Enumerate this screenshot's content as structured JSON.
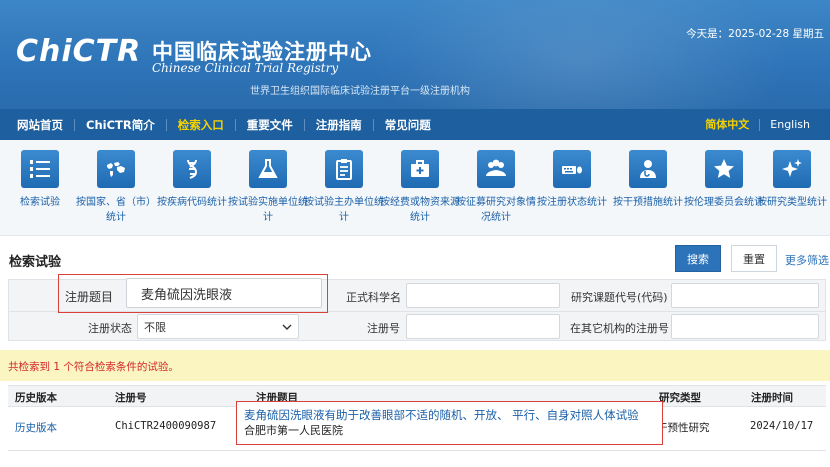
{
  "header": {
    "logo_mark": "ChiCTR",
    "site_name_cn": "中国临床试验注册中心",
    "site_name_en": "Chinese Clinical Trial Registry",
    "site_subtitle": "世界卫生组织国际临床试验注册平台一级注册机构",
    "today": "今天是：2025-02-28 星期五"
  },
  "nav": {
    "items": [
      {
        "label": "网站首页",
        "active": false
      },
      {
        "label": "ChiCTR简介",
        "active": false
      },
      {
        "label": "检索入口",
        "active": true
      },
      {
        "label": "重要文件",
        "active": false
      },
      {
        "label": "注册指南",
        "active": false
      },
      {
        "label": "常见问题",
        "active": false
      }
    ],
    "lang_cn": "简体中文",
    "lang_en": "English"
  },
  "icon_bar": {
    "items": [
      {
        "icon": "list-numbered-icon",
        "label": "检索试验"
      },
      {
        "icon": "world-map-icon",
        "label": "按国家、省（市）统计"
      },
      {
        "icon": "dna-icon",
        "label": "按疾病代码统计"
      },
      {
        "icon": "flask-icon",
        "label": "按试验实施单位统计"
      },
      {
        "icon": "clipboard-icon",
        "label": "按试验主办单位统计"
      },
      {
        "icon": "medical-kit-icon",
        "label": "按经费或物资来源统计"
      },
      {
        "icon": "people-group-icon",
        "label": "按征募研究对象情况统计"
      },
      {
        "icon": "keyboard-mouse-icon",
        "label": "按注册状态统计"
      },
      {
        "icon": "doctor-icon",
        "label": "按干预措施统计"
      },
      {
        "icon": "star-icon",
        "label": "按伦理委员会统计"
      },
      {
        "icon": "sparkle-icon",
        "label": "按研究类型统计"
      }
    ]
  },
  "search": {
    "title": "检索试验",
    "search_button": "搜索",
    "reset_button": "重置",
    "more_filters": "更多筛选",
    "fields": {
      "reg_title_label": "注册题目",
      "reg_title_value": "麦角硫因洗眼液",
      "sci_title_label": "正式科学名",
      "sci_title_value": "",
      "project_code_label": "研究课题代号(代码)",
      "project_code_value": "",
      "reg_status_label": "注册状态",
      "reg_status_value": "不限",
      "reg_no_label": "注册号",
      "reg_no_value": "",
      "other_reg_label": "在其它机构的注册号",
      "other_reg_value": ""
    }
  },
  "results": {
    "summary": "共检索到 1 个符合检索条件的试验。",
    "columns": [
      "历史版本",
      "注册号",
      "注册题目",
      "研究类型",
      "注册时间"
    ],
    "rows": [
      {
        "history": "历史版本",
        "reg_no": "ChiCTR2400090987",
        "title": "麦角硫因洗眼液有助于改善眼部不适的随机、开放、 平行、自身对照人体试验",
        "institution": "合肥市第一人民医院",
        "study_type": "干预性研究",
        "reg_date": "2024/10/17"
      }
    ]
  },
  "colors": {
    "header_blue": "#2e74b8",
    "nav_blue": "#1e5f9f",
    "active_yellow": "#f5d200",
    "link_blue": "#1a60a8",
    "highlight_red": "#d9403a",
    "result_bar": "#fbf5c2"
  }
}
